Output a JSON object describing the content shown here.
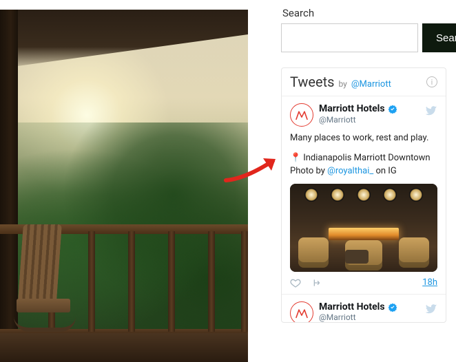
{
  "search": {
    "label": "Search",
    "button_label": "Search",
    "value": ""
  },
  "tweets_widget": {
    "title": "Tweets",
    "by_label": "by",
    "handle_link": "@Marriott"
  },
  "tweet1": {
    "display_name": "Marriott Hotels",
    "handle": "@Marriott",
    "line1": "Many places to work, rest and play.",
    "location_line": "Indianapolis Marriott Downtown",
    "photo_prefix": "Photo by ",
    "photo_credit_handle": "@royalthai_",
    "photo_suffix": " on IG",
    "timestamp": "18h"
  },
  "tweet2": {
    "display_name": "Marriott Hotels",
    "handle": "@Marriott"
  },
  "icons": {
    "pin": "📍"
  }
}
